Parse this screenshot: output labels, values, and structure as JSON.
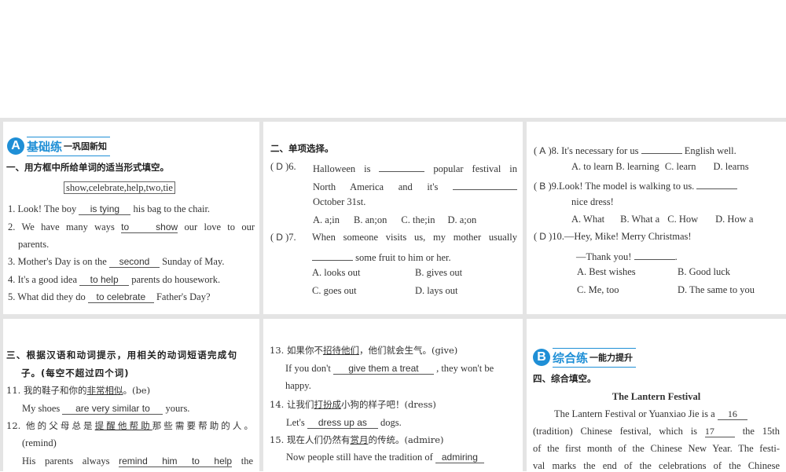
{
  "section_a": {
    "badge": "A",
    "title": "基础练",
    "subtitle": "一巩固新知"
  },
  "part1": {
    "instruction": "一、用方框中所给单词的适当形式填空。",
    "word_box": "show,celebrate,help,two,tie",
    "q1": {
      "pre": "1. Look!  The boy",
      "answer": "is tying",
      "post": "his bag to the chair."
    },
    "q2": {
      "pre": "2. We have many ways",
      "answer": "to show",
      "post": "our love to our",
      "cont": "parents."
    },
    "q3": {
      "pre": "3. Mother's Day is on the",
      "answer": "second",
      "post": "Sunday of May."
    },
    "q4": {
      "pre": "4. It's a good idea",
      "answer": "to help",
      "post": "parents do housework."
    },
    "q5": {
      "pre": "5. What did they do",
      "answer": "to celebrate",
      "post": "Father's Day?"
    }
  },
  "part2": {
    "instruction": "二、单项选择。",
    "q6": {
      "choice": "D",
      "num": ")6.",
      "l1a": "Halloween is",
      "l1b": "popular festival in",
      "l2a": "North America and it's",
      "l3": "October 31st.",
      "opts": [
        "A. a;in",
        "B. an;on",
        "C. the;in",
        "D. a;on"
      ]
    },
    "q7": {
      "choice": "D",
      "num": ")7.",
      "l1": "When someone visits us, my mother usually",
      "l2": "some fruit to him or her.",
      "opts": [
        "A. looks out",
        "B. gives out",
        "C. goes out",
        "D. lays out"
      ]
    },
    "q8": {
      "choice": "A",
      "num": ")8.",
      "l1a": "It's necessary for us",
      "l1b": "English well.",
      "opts": [
        "A. to learn",
        "B. learning",
        "C. learn",
        "D. learns"
      ]
    },
    "q9": {
      "choice": "B",
      "num": ")9.",
      "l1": "Look!  The model is walking to us.",
      "l2": "nice dress!",
      "opts": [
        "A. What",
        "B. What a",
        "C. How",
        "D. How a"
      ]
    },
    "q10": {
      "choice": "D",
      "num": ")10.",
      "l1": "—Hey, Mike!  Merry Christmas!",
      "l2": "—Thank you!",
      "l2b": ".",
      "opts": [
        "A. Best wishes",
        "B. Good luck",
        "C. Me, too",
        "D. The same to you"
      ]
    }
  },
  "part3": {
    "instruction_1": "三、根据汉语和动词提示，用相关的动词短语完成句",
    "instruction_2": "子。(每空不超过四个词)",
    "q11": {
      "cn_pre": "11. 我的鞋子和你的",
      "cn_u": "非常相似",
      "cn_post": "。(be)",
      "pre": "My shoes",
      "answer": "are very similar to",
      "post": "yours."
    },
    "q12": {
      "cn_pre": "12. 他的父母总是",
      "cn_u": "提醒他帮助",
      "cn_post": "那些需要帮助的人。",
      "hint": "(remind)",
      "pre": "His parents always",
      "answer": "remind him to help",
      "post": "the"
    },
    "q13": {
      "cn_pre": "13. 如果你不",
      "cn_u": "招待他们",
      "cn_post": "，他们就会生气。(give)",
      "pre": "If you don't",
      "answer": "give them a treat",
      "post": ", they won't be",
      "cont": "happy."
    },
    "q14": {
      "cn_pre": "14. 让我们",
      "cn_u": "打扮成",
      "cn_post": "小狗的样子吧！(dress)",
      "pre": "Let's",
      "answer": "dress up as",
      "post": "dogs."
    },
    "q15": {
      "cn_pre": "15. 现在人们仍然有",
      "cn_u": "赏月",
      "cn_post": "的传统。(admire)",
      "pre": "Now people still have the tradition of",
      "answer": "admiring"
    }
  },
  "section_b": {
    "badge": "B",
    "title": "综合练",
    "subtitle": "一能力提升"
  },
  "part4": {
    "instruction": "四、综合填空。",
    "title": "The Lantern Festival",
    "l1a": "The Lantern Festival or Yuanxiao Jie is a",
    "b16": "16",
    "l2a": "(tradition) Chinese festival, which is",
    "b17": "17",
    "l2b": "the 15th",
    "l3": "of the first month of the Chinese New Year. The festi-",
    "l4": "val marks the end of the celebrations of the Chinese"
  }
}
